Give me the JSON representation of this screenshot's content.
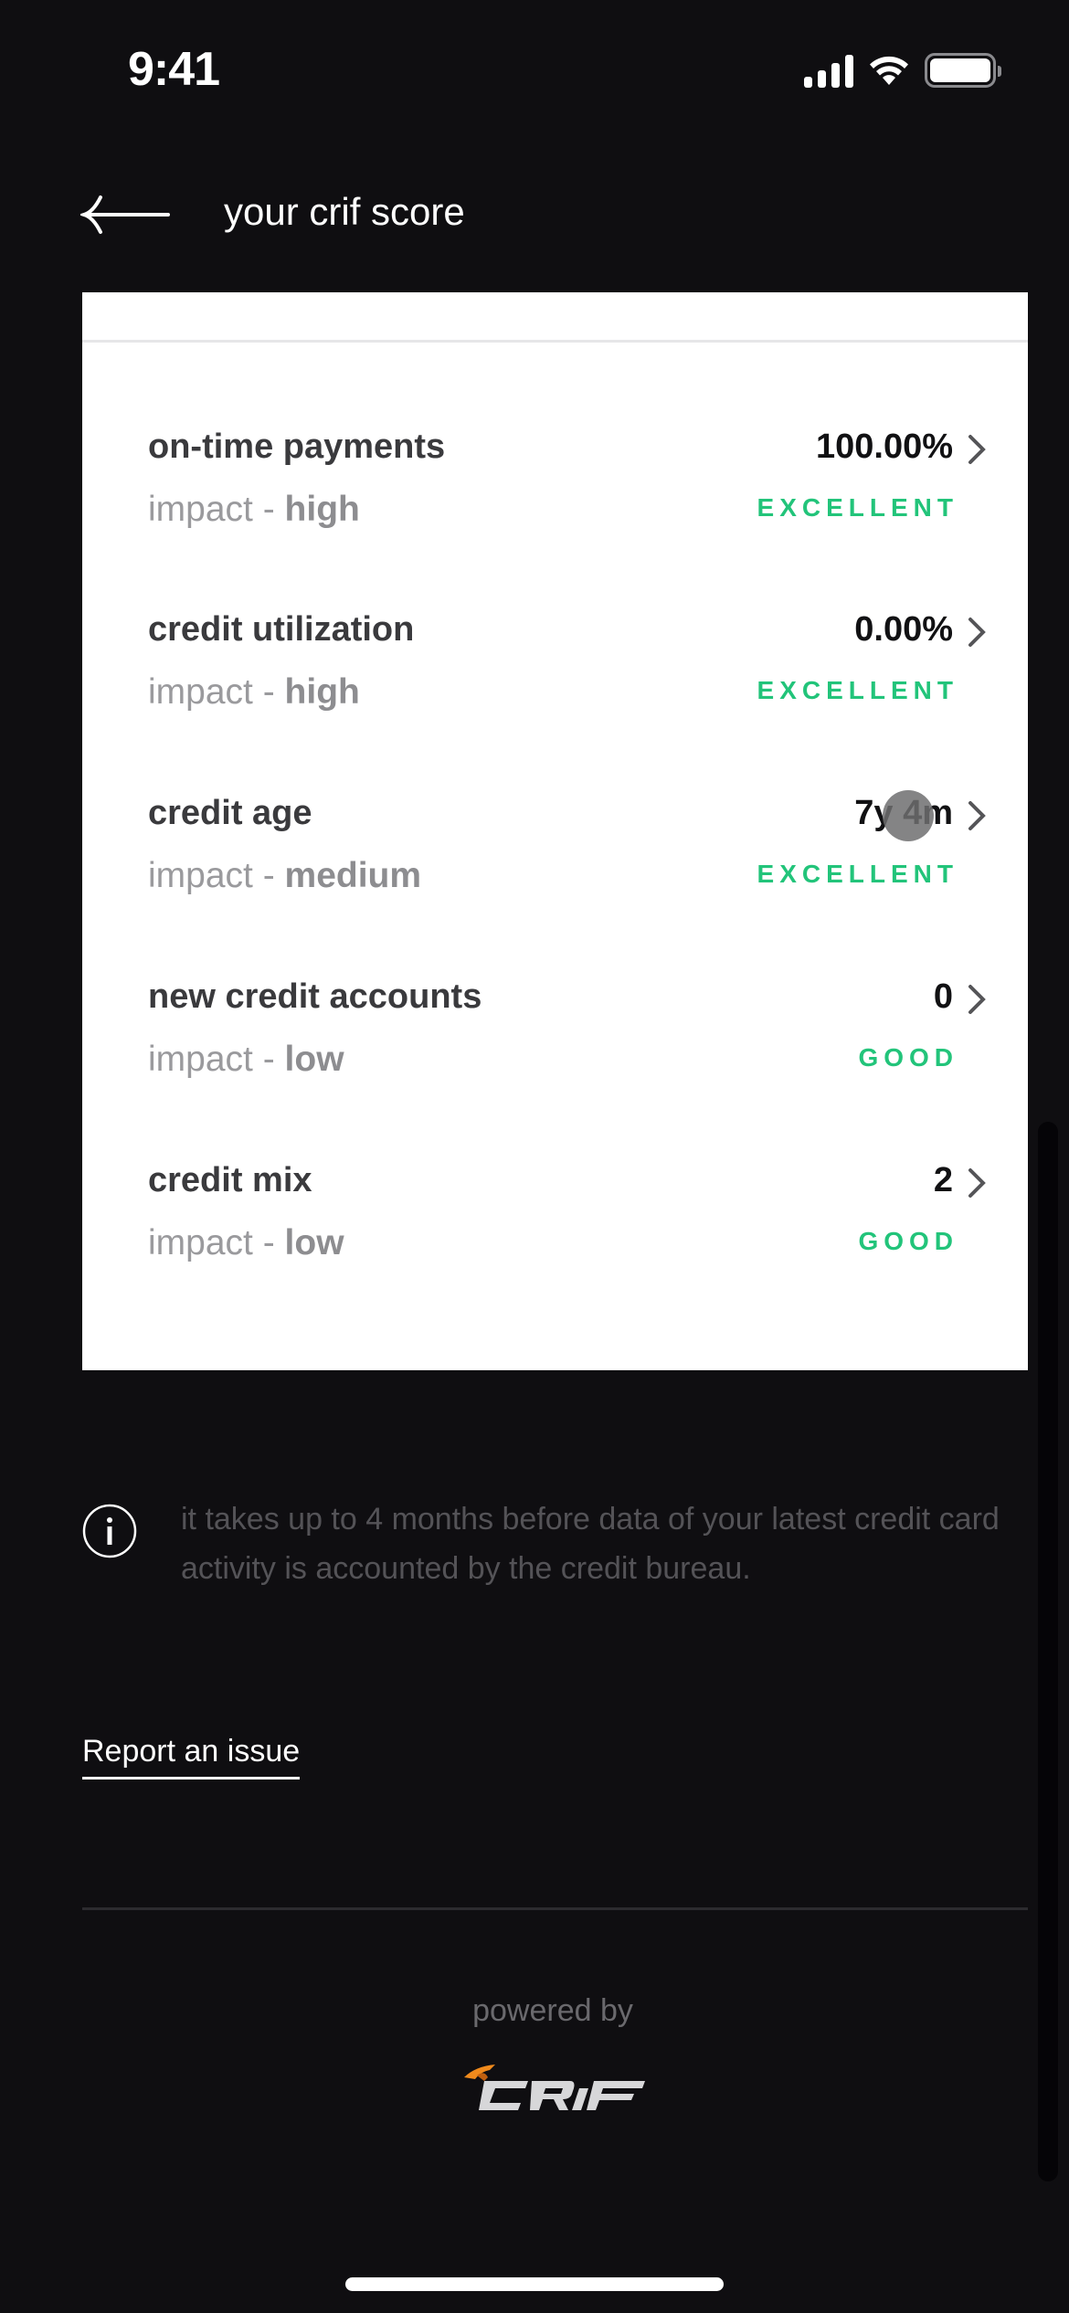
{
  "status_bar": {
    "time": "9:41",
    "icons": [
      "cellular-signal-icon",
      "wifi-icon",
      "battery-icon"
    ]
  },
  "header": {
    "back_icon": "arrow-left-icon",
    "title": "your crif score"
  },
  "factors": [
    {
      "name": "on-time payments",
      "impact_prefix": "impact - ",
      "impact": "high",
      "value": "100.00%",
      "rating": "EXCELLENT"
    },
    {
      "name": "credit utilization",
      "impact_prefix": "impact - ",
      "impact": "high",
      "value": "0.00%",
      "rating": "EXCELLENT"
    },
    {
      "name": "credit age",
      "impact_prefix": "impact - ",
      "impact": "medium",
      "value": "7y 4m",
      "rating": "EXCELLENT"
    },
    {
      "name": "new credit accounts",
      "impact_prefix": "impact - ",
      "impact": "low",
      "value": "0",
      "rating": "GOOD"
    },
    {
      "name": "credit mix",
      "impact_prefix": "impact - ",
      "impact": "low",
      "value": "2",
      "rating": "GOOD"
    }
  ],
  "colors": {
    "background": "#0f0e11",
    "card": "#ffffff",
    "rating_green": "#22c47a",
    "crif_orange": "#f08a1c"
  },
  "info": {
    "icon": "info-icon",
    "text": "it takes up to 4 months before data of your latest credit card activity is accounted by the credit bureau."
  },
  "report_link": "Report an issue",
  "footer": {
    "powered_by": "powered by",
    "logo_text": "CRIF"
  }
}
